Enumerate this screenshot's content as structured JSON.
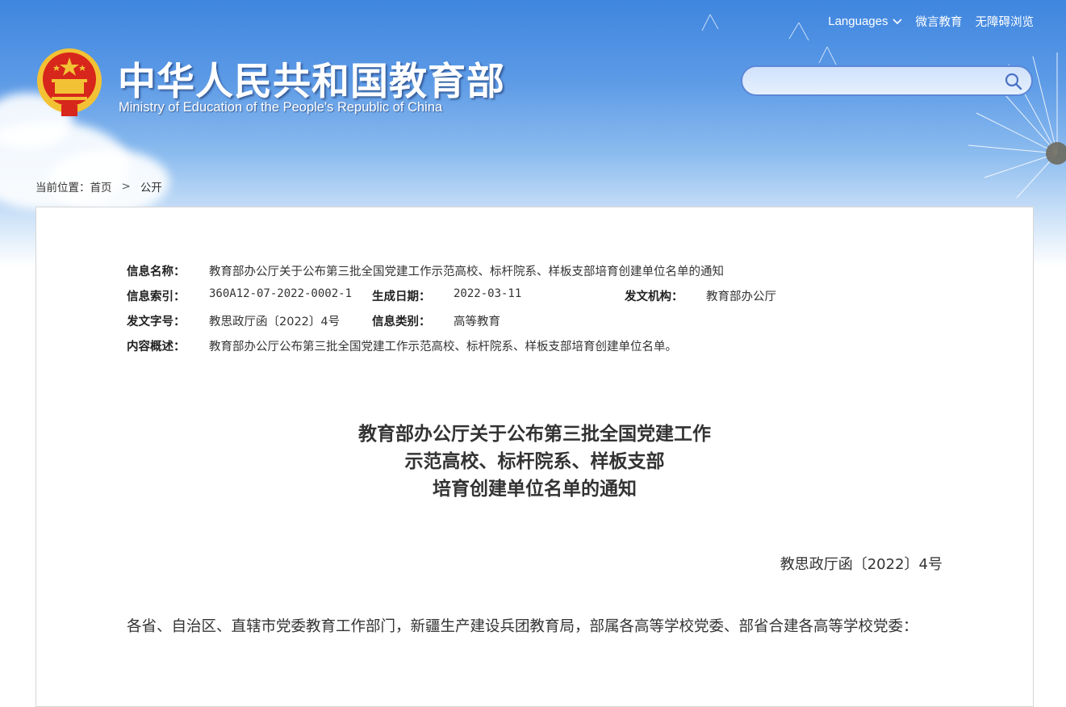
{
  "header": {
    "title_cn": "中华人民共和国教育部",
    "title_en": "Ministry of Education of the People's Republic of China",
    "languages_label": "Languages",
    "links": [
      "微言教育",
      "无障碍浏览"
    ],
    "search": {
      "value": "",
      "placeholder": ""
    }
  },
  "breadcrumb": {
    "prefix": "当前位置：",
    "items": [
      "首页",
      "公开"
    ],
    "separator": ">"
  },
  "meta": {
    "name_label": "信息名称：",
    "name_value": "教育部办公厅关于公布第三批全国党建工作示范高校、标杆院系、样板支部培育创建单位名单的通知",
    "index_label": "信息索引：",
    "index_value": "360A12-07-2022-0002-1",
    "date_label": "生成日期：",
    "date_value": "2022-03-11",
    "org_label": "发文机构：",
    "org_value": "教育部办公厅",
    "doc_no_label": "发文字号：",
    "doc_no_value": "教思政厅函〔2022〕4号",
    "category_label": "信息类别：",
    "category_value": "高等教育",
    "summary_label": "内容概述：",
    "summary_value": "教育部办公厅公布第三批全国党建工作示范高校、标杆院系、样板支部培育创建单位名单。"
  },
  "article": {
    "title_lines": [
      "教育部办公厅关于公布第三批全国党建工作",
      "示范高校、标杆院系、样板支部",
      "培育创建单位名单的通知"
    ],
    "doc_number": "教思政厅函〔2022〕4号",
    "body": "各省、自治区、直辖市党委教育工作部门，新疆生产建设兵团教育局，部属各高等学校党委、部省合建各高等学校党委："
  },
  "colors": {
    "banner_top": "#3f86df",
    "text": "#333333",
    "search_border": "#5c87d8",
    "emblem_red": "#d7261b",
    "emblem_gold": "#f3c234"
  },
  "icons": [
    "national-emblem-icon",
    "chevron-down-icon",
    "search-icon",
    "dandelion-icon"
  ]
}
